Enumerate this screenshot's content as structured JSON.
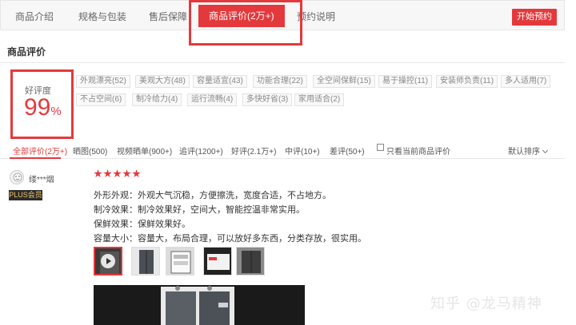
{
  "tabs": [
    {
      "label": "商品介绍"
    },
    {
      "label": "规格与包装"
    },
    {
      "label": "售后保障"
    },
    {
      "label": "商品评价(2万+)"
    },
    {
      "label": "预约说明"
    }
  ],
  "buy_button": "开始预约",
  "section_title": "商品评价",
  "rating": {
    "label": "好评度",
    "value": "99",
    "unit": "%"
  },
  "tags": [
    "外观漂亮(52)",
    "美观大方(48)",
    "容量适宜(43)",
    "功能合理(22)",
    "全空间保鲜(15)",
    "易于操控(11)",
    "安装师负责(11)",
    "多人适用(7)",
    "不占空间(6)",
    "制冷给力(4)",
    "运行流畅(4)",
    "多快好省(3)",
    "家用适合(2)"
  ],
  "filters": [
    "全部评价(2万+)",
    "晒图(500)",
    "视频晒单(900+)",
    "追评(1200+)",
    "好评(2.1万+)",
    "中评(10+)",
    "差评(50+)"
  ],
  "only_current": "只看当前商品评价",
  "sort": "默认排序",
  "review": {
    "username": "缕***烟",
    "badge": "PLUS会员",
    "stars": 5,
    "lines": [
      "外形外观：外观大气沉稳，方便擦洗，宽度合适，不占地方。",
      "制冷效果：制冷效果好，空间大，智能控温非常实用。",
      "保鲜效果：保鲜效果好。",
      "容量大小：容量大，布局合理，可以放好多东西，分类存放，很实用。"
    ]
  },
  "watermark": "知乎 @龙马精神",
  "colors": {
    "accent": "#e4393c"
  }
}
